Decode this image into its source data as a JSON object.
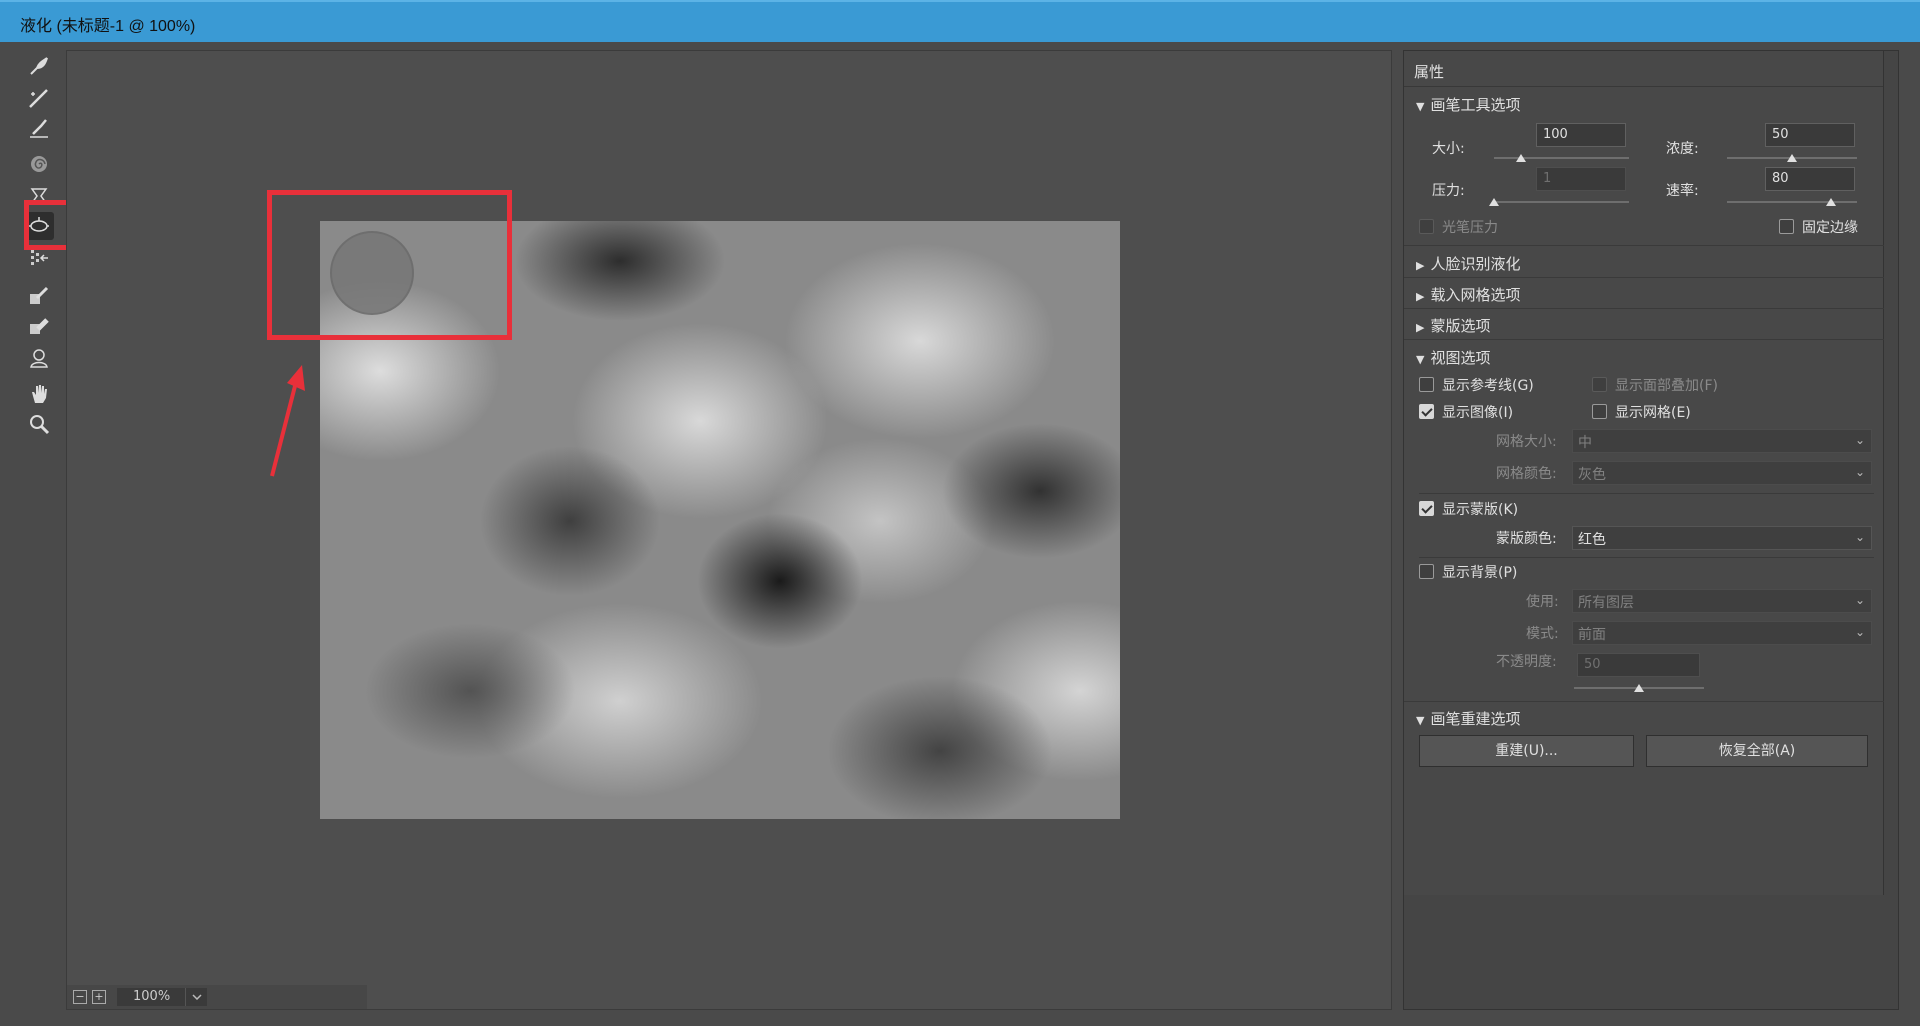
{
  "window": {
    "title": "液化 (未标题-1 @ 100%)"
  },
  "tools": [
    {
      "name": "forward-warp-tool",
      "icon": "forward-warp-icon"
    },
    {
      "name": "reconstruct-tool",
      "icon": "reconstruct-brush-icon"
    },
    {
      "name": "smooth-tool",
      "icon": "smooth-brush-icon"
    },
    {
      "name": "twirl-tool",
      "icon": "twirl-icon"
    },
    {
      "name": "pucker-tool",
      "icon": "pucker-icon"
    },
    {
      "name": "bloat-tool",
      "icon": "bloat-icon"
    },
    {
      "name": "push-left-tool",
      "icon": "push-left-icon"
    },
    {
      "name": "freeze-mask-tool",
      "icon": "freeze-mask-icon"
    },
    {
      "name": "thaw-mask-tool",
      "icon": "thaw-mask-icon"
    },
    {
      "name": "face-tool",
      "icon": "face-icon"
    },
    {
      "name": "hand-tool",
      "icon": "hand-icon"
    },
    {
      "name": "zoom-tool",
      "icon": "zoom-icon"
    }
  ],
  "zoom": {
    "value": "100%"
  },
  "panel": {
    "header": "属性",
    "brush_tool_options": {
      "title": "画笔工具选项",
      "size_label": "大小:",
      "size_value": "100",
      "density_label": "浓度:",
      "density_value": "50",
      "pressure_label": "压力:",
      "pressure_value": "1",
      "rate_label": "速率:",
      "rate_value": "80",
      "stylus_pressure_label": "光笔压力",
      "pin_edges_label": "固定边缘"
    },
    "face_aware": {
      "title": "人脸识别液化"
    },
    "load_mesh": {
      "title": "载入网格选项"
    },
    "mask_options": {
      "title": "蒙版选项"
    },
    "view_options": {
      "title": "视图选项",
      "show_guides": "显示参考线(G)",
      "show_face_overlay": "显示面部叠加(F)",
      "show_image": "显示图像(I)",
      "show_mesh": "显示网格(E)",
      "mesh_size_label": "网格大小:",
      "mesh_size_value": "中",
      "mesh_color_label": "网格颜色:",
      "mesh_color_value": "灰色",
      "show_mask": "显示蒙版(K)",
      "mask_color_label": "蒙版颜色:",
      "mask_color_value": "红色",
      "show_backdrop": "显示背景(P)",
      "use_label": "使用:",
      "use_value": "所有图层",
      "mode_label": "模式:",
      "mode_value": "前面",
      "opacity_label": "不透明度:",
      "opacity_value": "50"
    },
    "brush_reconstruct": {
      "title": "画笔重建选项",
      "reconstruct_button": "重建(U)...",
      "restore_all_button": "恢复全部(A)"
    }
  },
  "slider_levels": {
    "size": 0.2,
    "density": 0.5,
    "pressure": 0.0,
    "rate": 0.8,
    "opacity": 0.5
  },
  "colors": {
    "titlebar": "#3a9ad4",
    "highlight": "#e8303a"
  }
}
